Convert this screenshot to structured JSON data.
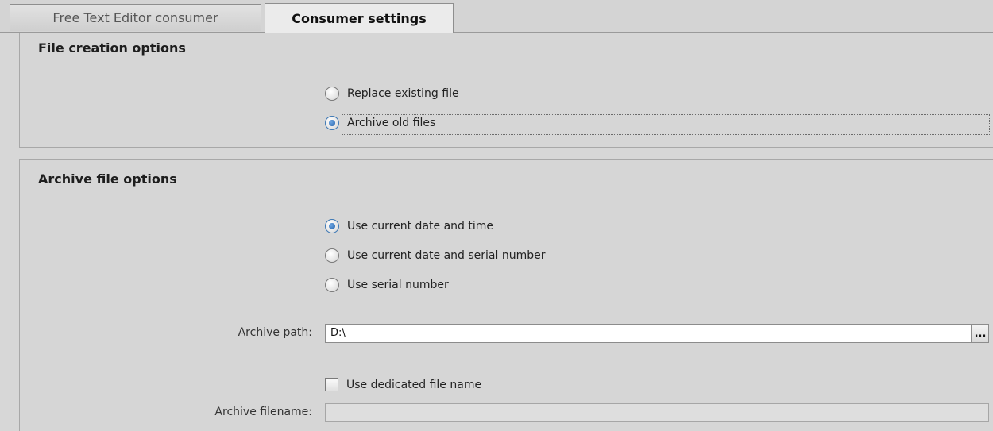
{
  "tabs": [
    {
      "label": "Free Text Editor consumer",
      "active": false
    },
    {
      "label": "Consumer settings",
      "active": true
    }
  ],
  "file_creation": {
    "title": "File creation options",
    "options": [
      {
        "label": "Replace existing file",
        "selected": false
      },
      {
        "label": "Archive old files",
        "selected": true
      }
    ]
  },
  "archive_options": {
    "title": "Archive file options",
    "options": [
      {
        "label": "Use current date and time",
        "selected": true
      },
      {
        "label": "Use current date and serial number",
        "selected": false
      },
      {
        "label": "Use serial number",
        "selected": false
      }
    ],
    "archive_path_label": "Archive path:",
    "archive_path_value": "D:\\",
    "browse_label": "...",
    "dedicated_name_label": "Use dedicated file name",
    "dedicated_name_checked": false,
    "archive_filename_label": "Archive filename:",
    "archive_filename_value": ""
  },
  "colors": {
    "background": "#d7d7d7",
    "radio_selected": "#1f5fa8"
  },
  "icons": {
    "browse": "ellipsis-icon"
  }
}
